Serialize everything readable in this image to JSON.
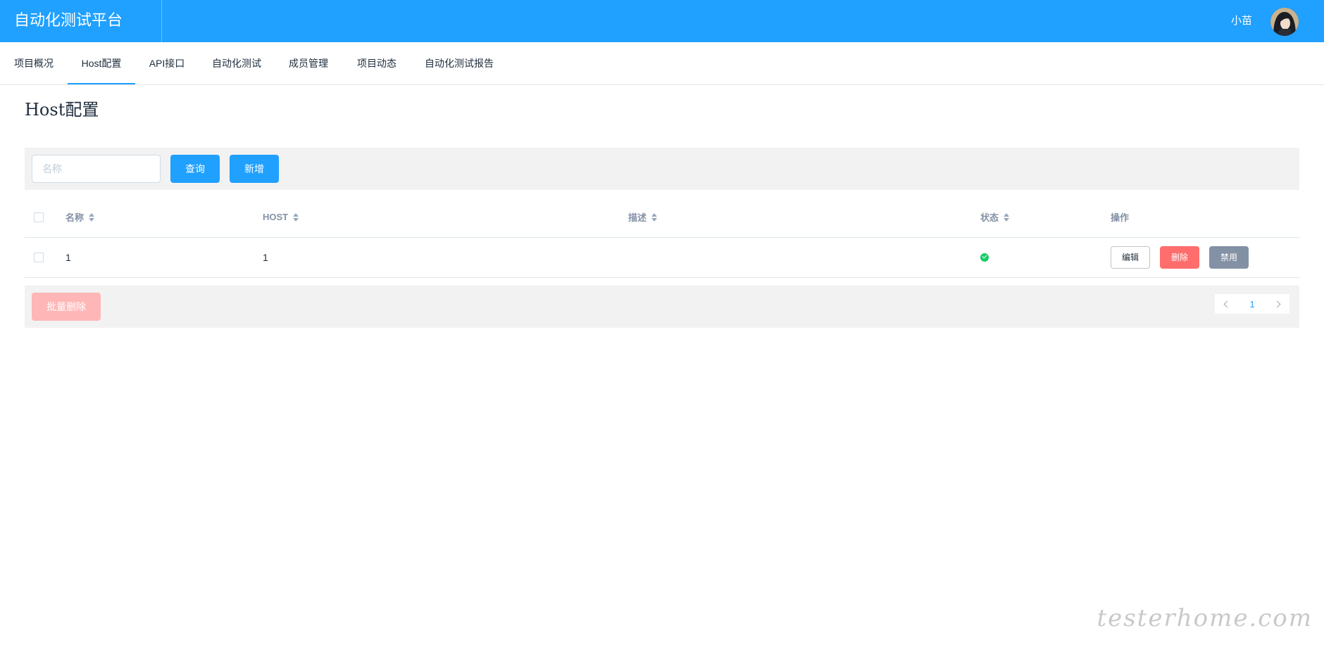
{
  "header": {
    "brand": "自动化测试平台",
    "user_name": "小苗",
    "colors": {
      "primary": "#20a0ff"
    }
  },
  "tabs": [
    {
      "label": "项目概况",
      "active": false
    },
    {
      "label": "Host配置",
      "active": true
    },
    {
      "label": "API接口",
      "active": false
    },
    {
      "label": "自动化测试",
      "active": false
    },
    {
      "label": "成员管理",
      "active": false
    },
    {
      "label": "项目动态",
      "active": false
    },
    {
      "label": "自动化测试报告",
      "active": false
    }
  ],
  "page": {
    "title": "Host配置"
  },
  "toolbar": {
    "search_placeholder": "名称",
    "search_value": "",
    "query_label": "查询",
    "add_label": "新增"
  },
  "table": {
    "columns": [
      "名称",
      "HOST",
      "描述",
      "状态",
      "操作"
    ],
    "rows": [
      {
        "name": "1",
        "host": "1",
        "description": "",
        "status": "enabled"
      }
    ],
    "actions": {
      "edit": "编辑",
      "delete": "删除",
      "disable": "禁用"
    }
  },
  "footer": {
    "batch_delete_label": "批量删除",
    "current_page": "1"
  },
  "watermark": "testerhome.com"
}
